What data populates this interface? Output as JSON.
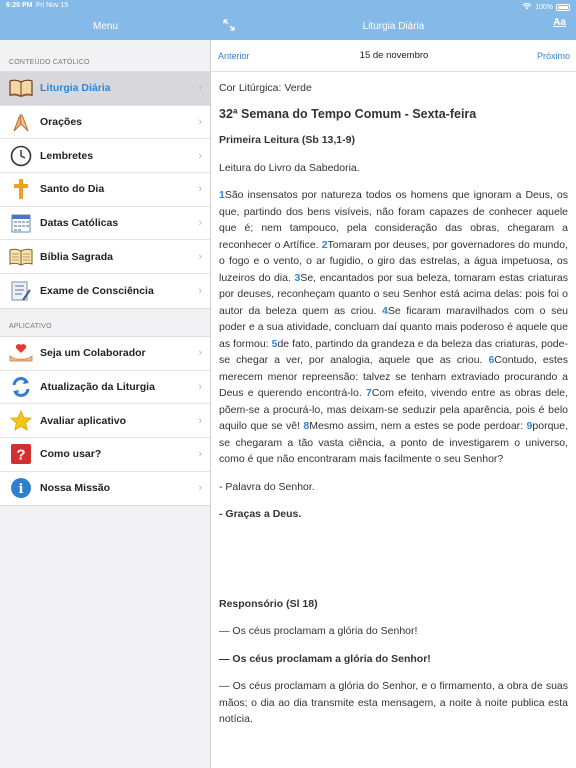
{
  "status": {
    "time": "6:20 PM",
    "date": "Fri Nov 15",
    "battery": "100%"
  },
  "nav": {
    "left_title": "Menu",
    "right_title": "Liturgia Diária",
    "font_button": "Aa"
  },
  "sidebar": {
    "section1": "CONTEÚDO CATÓLICO",
    "items1": [
      {
        "label": "Liturgia Diária",
        "icon": "book-icon"
      },
      {
        "label": "Orações",
        "icon": "praying-hands-icon"
      },
      {
        "label": "Lembretes",
        "icon": "clock-icon"
      },
      {
        "label": "Santo do Dia",
        "icon": "cross-icon"
      },
      {
        "label": "Datas Católicas",
        "icon": "calendar-icon"
      },
      {
        "label": "Bíblia Sagrada",
        "icon": "bible-icon"
      },
      {
        "label": "Exame de Consciência",
        "icon": "checklist-icon"
      }
    ],
    "section2": "APLICATIVO",
    "items2": [
      {
        "label": "Seja um Colaborador",
        "icon": "heart-hands-icon"
      },
      {
        "label": "Atualização da Liturgia",
        "icon": "refresh-icon"
      },
      {
        "label": "Avaliar aplicativo",
        "icon": "star-icon"
      },
      {
        "label": "Como usar?",
        "icon": "question-icon"
      },
      {
        "label": "Nossa Missão",
        "icon": "info-icon"
      }
    ]
  },
  "pager": {
    "prev": "Anterior",
    "date": "15 de novembro",
    "next": "Próximo"
  },
  "reading": {
    "color": "Cor Litúrgica: Verde",
    "week": "32ª Semana do Tempo Comum - Sexta-feira",
    "first_title": "Primeira Leitura (Sb 13,1-9)",
    "first_intro": "Leitura do Livro da Sabedoria.",
    "verses": [
      {
        "n": "1",
        "t": "São insensatos por natureza todos os homens que ignoram a Deus, os que, partindo dos bens visíveis, não foram capazes de conhecer aquele que é; nem tampouco, pela consideração das obras, chegaram a reconhecer o Artífice. "
      },
      {
        "n": "2",
        "t": "Tomaram por deuses, por governadores do mundo, o fogo e o vento, o ar fugidio, o giro das estrelas, a água impetuosa, os luzeiros do dia. "
      },
      {
        "n": "3",
        "t": "Se, encantados por sua beleza, tomaram estas criaturas por deuses, reconheçam quanto o seu Senhor está acima delas: pois foi o autor da beleza quem as criou. "
      },
      {
        "n": "4",
        "t": "Se ficaram maravilhados com o seu poder e a sua atividade, concluam daí quanto mais poderoso é aquele que as formou: "
      },
      {
        "n": "5",
        "t": "de fato, partindo da grandeza e da beleza das criaturas, pode-se chegar a ver, por analogia, aquele que as criou. "
      },
      {
        "n": "6",
        "t": "Contudo, estes merecem menor repreensão: talvez se tenham extraviado procurando a Deus e querendo encontrá-lo. "
      },
      {
        "n": "7",
        "t": "Com efeito, vivendo entre as obras dele, põem-se a procurá-lo, mas deixam-se seduzir pela aparência, pois é belo aquilo que se vê! "
      },
      {
        "n": "8",
        "t": "Mesmo assim, nem a estes se pode perdoar: "
      },
      {
        "n": "9",
        "t": "porque, se chegaram a tão vasta ciência, a ponto de investigarem o universo, como é que não encontraram mais facilmente o seu Senhor?"
      }
    ],
    "closing": "- Palavra do Senhor.",
    "response": "- Graças a Deus.",
    "psalm_title": "Responsório (Sl 18)",
    "psalm_refrain": "— Os céus proclamam a glória do Senhor!",
    "psalm_refrain_bold": "— Os céus proclamam a glória do Senhor!",
    "psalm_verse": "— Os céus proclamam a glória do Senhor, e o firmamento, a obra de suas mãos; o dia ao dia transmite esta mensagem, a noite à noite publica esta notícia."
  },
  "colors": {
    "nav": "#85b9e8",
    "accent": "#2f86d6",
    "selected_bg": "#d8d8dc"
  }
}
